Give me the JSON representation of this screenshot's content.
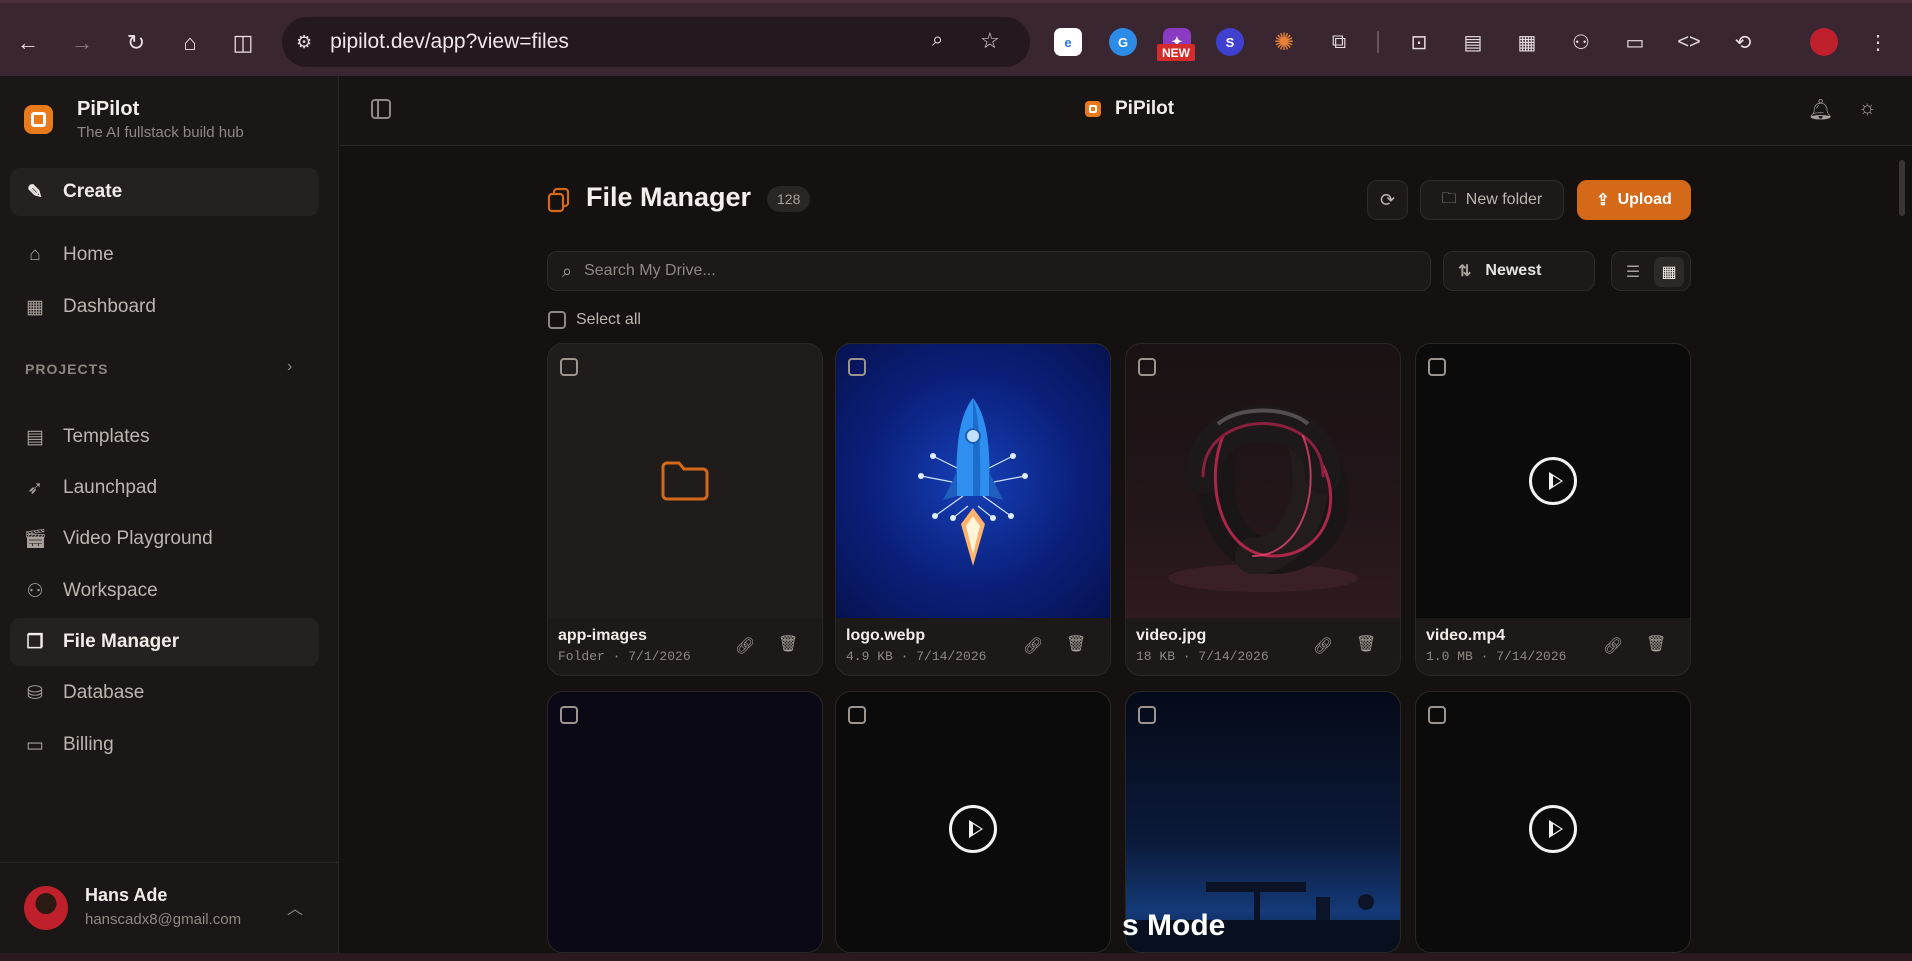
{
  "browser": {
    "url": "pipilot.dev/app?view=files",
    "new_badge": "NEW"
  },
  "app": {
    "name": "PiPilot",
    "tagline": "The AI fullstack build hub"
  },
  "sidebar": {
    "items": [
      {
        "label": "Create",
        "icon": "magic-wand-icon"
      },
      {
        "label": "Home",
        "icon": "home-icon"
      },
      {
        "label": "Dashboard",
        "icon": "dashboard-icon"
      },
      {
        "label": "Templates",
        "icon": "templates-icon"
      },
      {
        "label": "Launchpad",
        "icon": "rocket-icon"
      },
      {
        "label": "Video Playground",
        "icon": "clapper-icon"
      },
      {
        "label": "Workspace",
        "icon": "users-icon"
      },
      {
        "label": "File Manager",
        "icon": "files-icon"
      },
      {
        "label": "Database",
        "icon": "database-icon"
      },
      {
        "label": "Billing",
        "icon": "card-icon"
      }
    ],
    "projects_label": "PROJECTS",
    "user": {
      "name": "Hans Ade",
      "email": "hanscadx8@gmail.com"
    }
  },
  "topbar": {
    "title": "PiPilot"
  },
  "file_manager": {
    "title": "File Manager",
    "count": "128",
    "new_folder_label": "New folder",
    "upload_label": "Upload",
    "search_placeholder": "Search My Drive...",
    "sort_label": "Newest",
    "select_all_label": "Select all",
    "files": [
      {
        "name": "app-images",
        "meta": "Folder · 7/1/2026",
        "kind": "folder"
      },
      {
        "name": "logo.webp",
        "meta": "4.9 KB · 7/14/2026",
        "kind": "image-rocket"
      },
      {
        "name": "video.jpg",
        "meta": "18 KB · 7/14/2026",
        "kind": "image-knot"
      },
      {
        "name": "video.mp4",
        "meta": "1.0 MB · 7/14/2026",
        "kind": "video"
      },
      {
        "name": "",
        "meta": "",
        "kind": "image-dark"
      },
      {
        "name": "",
        "meta": "",
        "kind": "video"
      },
      {
        "name": "",
        "meta": "",
        "kind": "image-room"
      },
      {
        "name": "",
        "meta": "",
        "kind": "video"
      }
    ]
  },
  "overlay_caption": "s Mode",
  "colors": {
    "accent": "#d4691a",
    "sidebar_bg": "#1a1716",
    "page_bg": "#141110",
    "chrome": "#3a2631"
  }
}
